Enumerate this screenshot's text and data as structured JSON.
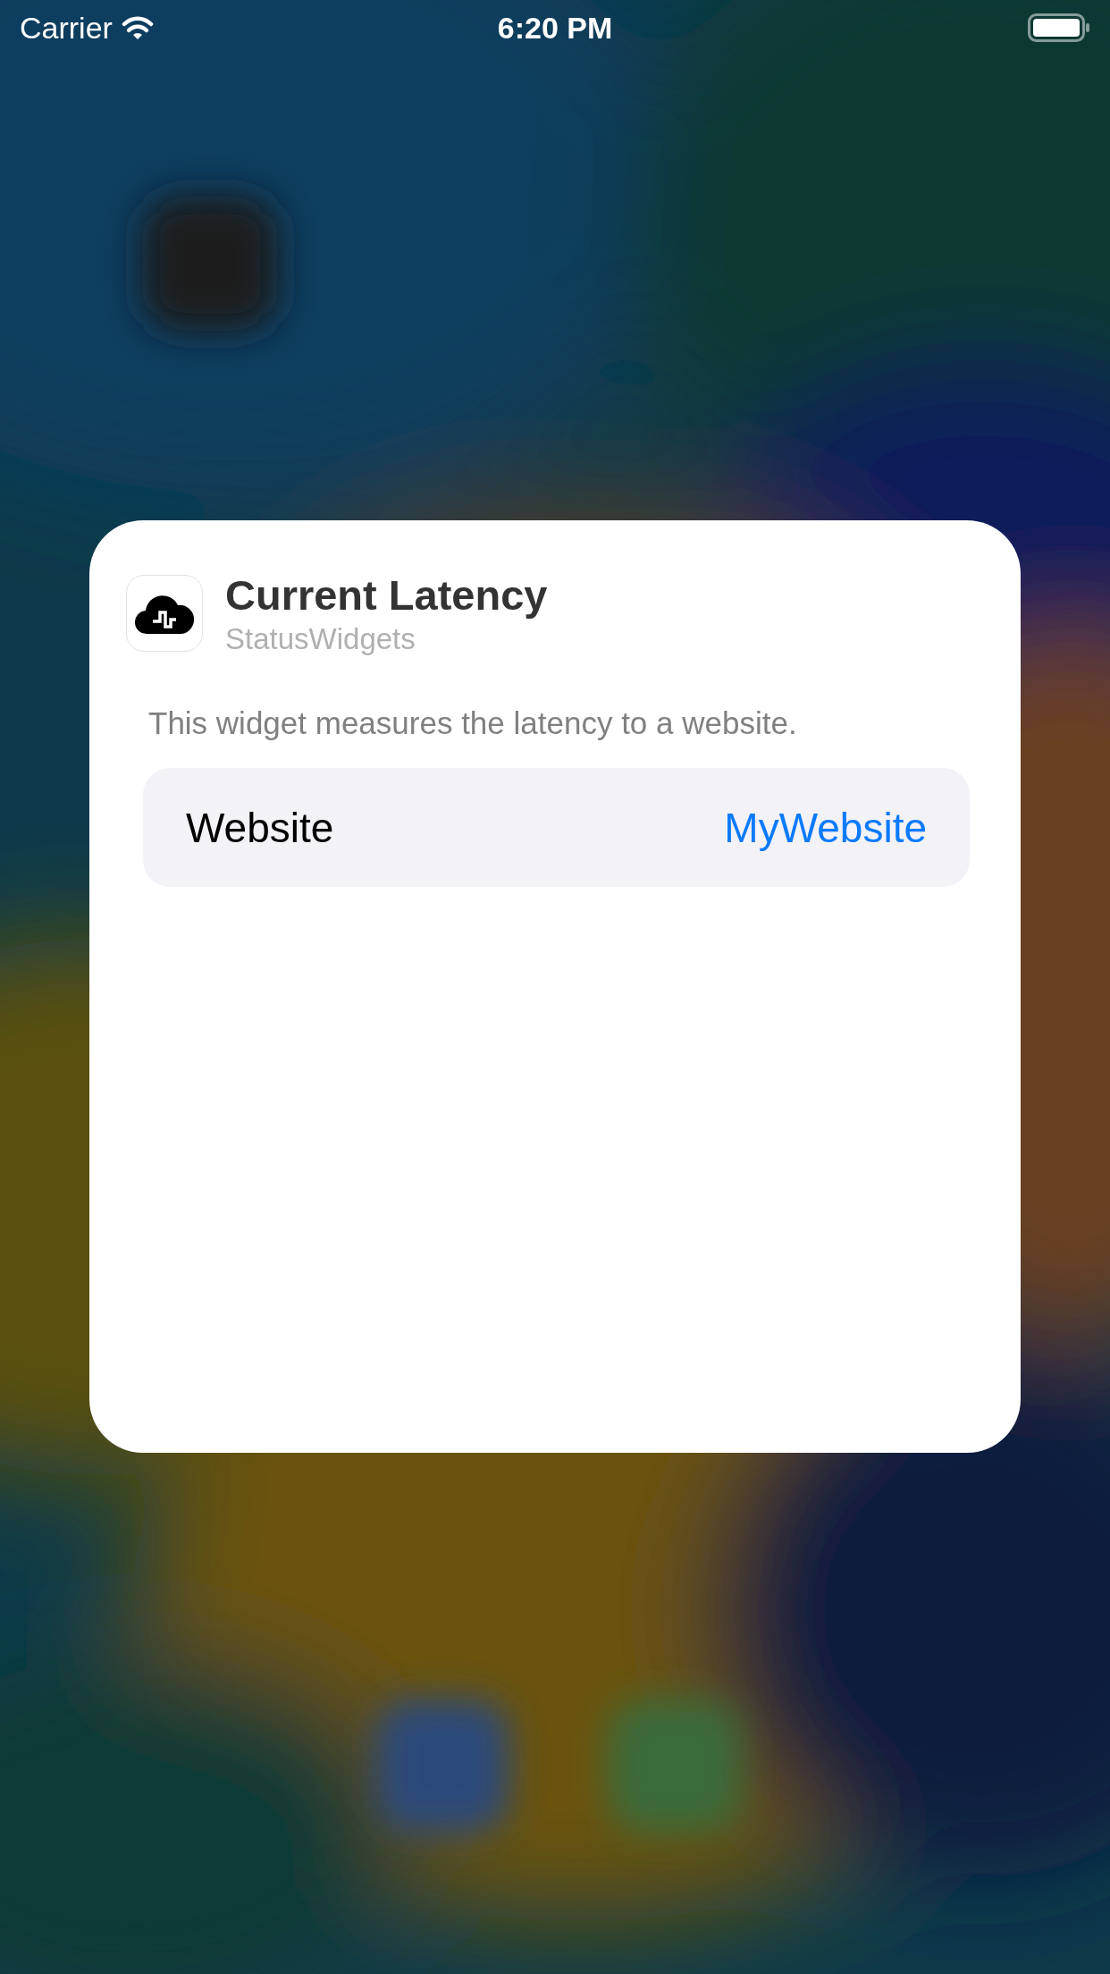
{
  "status_bar": {
    "carrier": "Carrier",
    "time": "6:20 PM"
  },
  "widget": {
    "title": "Current Latency",
    "app": "StatusWidgets",
    "description": "This widget measures the latency to a website.",
    "parameters": [
      {
        "label": "Website",
        "value": "MyWebsite"
      }
    ]
  }
}
